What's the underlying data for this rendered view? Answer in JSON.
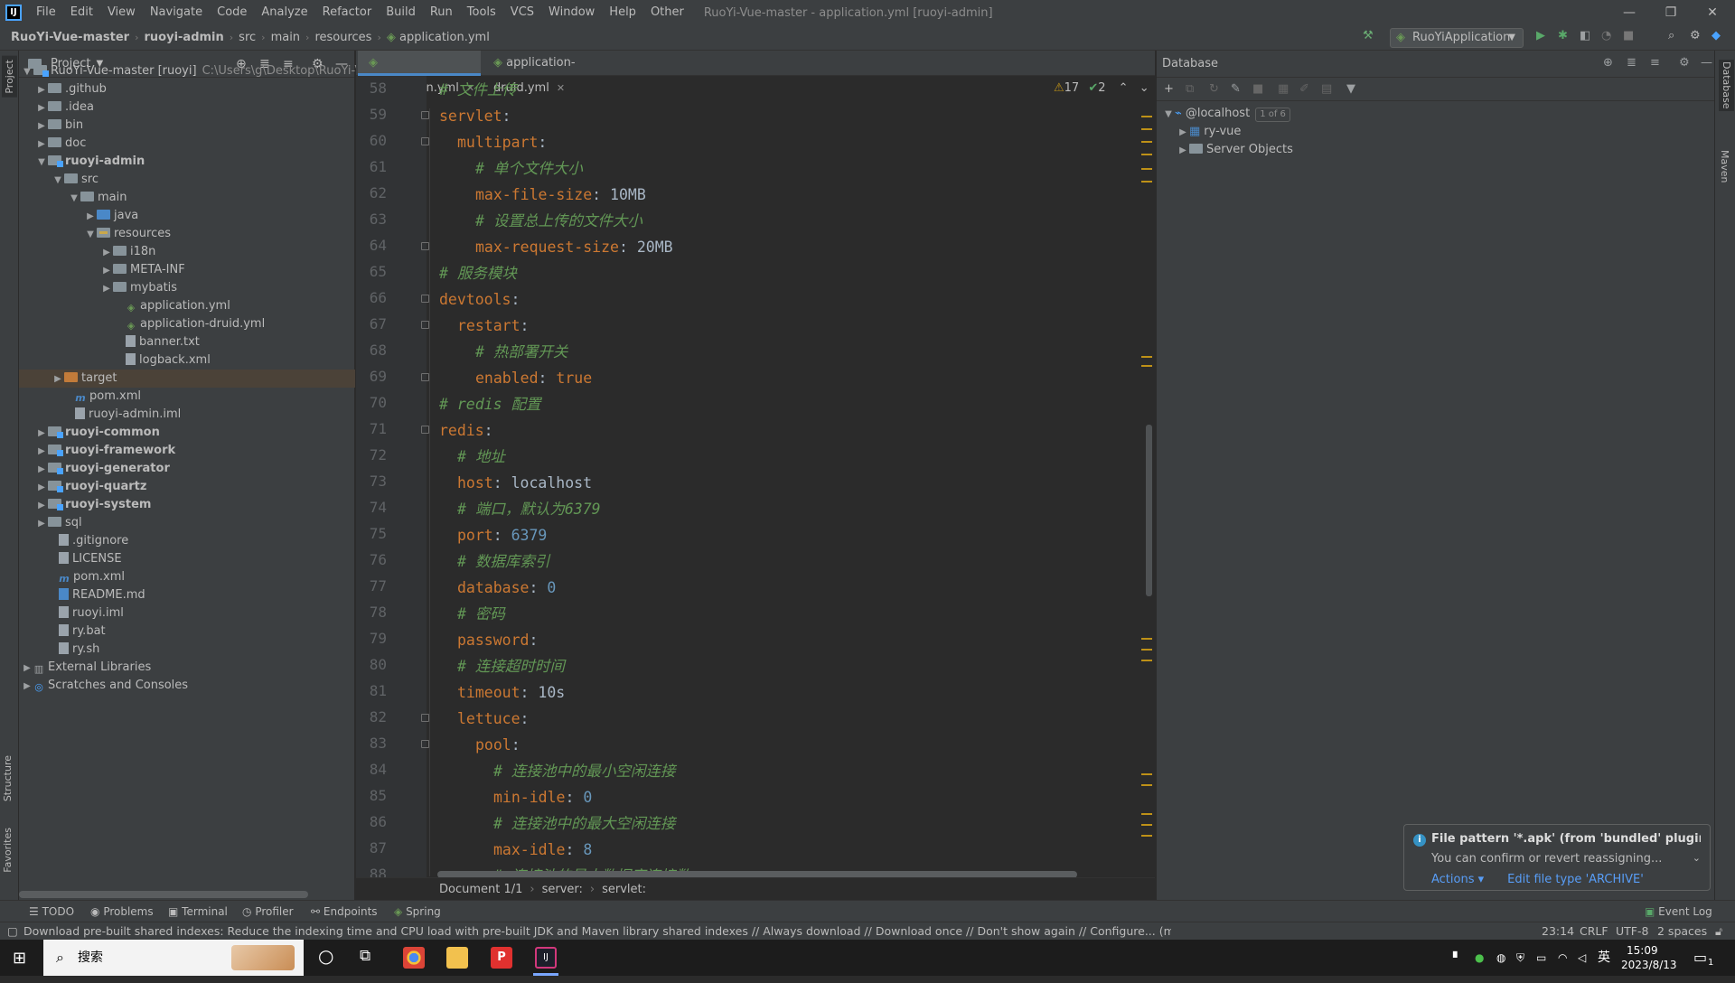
{
  "menubar": {
    "logo": "IJ",
    "items": [
      "File",
      "Edit",
      "View",
      "Navigate",
      "Code",
      "Analyze",
      "Refactor",
      "Build",
      "Run",
      "Tools",
      "VCS",
      "Window",
      "Help",
      "Other"
    ],
    "window_title": "RuoYi-Vue-master - application.yml [ruoyi-admin]"
  },
  "breadcrumb": [
    "RuoYi-Vue-master",
    "ruoyi-admin",
    "src",
    "main",
    "resources",
    "application.yml"
  ],
  "run_config": "RuoYiApplication",
  "project_panel": {
    "title": "Project",
    "tree": [
      {
        "label": "RuoYi-Vue-master [ruoyi]",
        "extra": "C:\\Users\\g\\Desktop\\RuoYi-Vu"
      },
      {
        "label": ".github"
      },
      {
        "label": ".idea"
      },
      {
        "label": "bin"
      },
      {
        "label": "doc"
      },
      {
        "label": "ruoyi-admin"
      },
      {
        "label": "src"
      },
      {
        "label": "main"
      },
      {
        "label": "java"
      },
      {
        "label": "resources"
      },
      {
        "label": "i18n"
      },
      {
        "label": "META-INF"
      },
      {
        "label": "mybatis"
      },
      {
        "label": "application.yml"
      },
      {
        "label": "application-druid.yml"
      },
      {
        "label": "banner.txt"
      },
      {
        "label": "logback.xml"
      },
      {
        "label": "target"
      },
      {
        "label": "pom.xml"
      },
      {
        "label": "ruoyi-admin.iml"
      },
      {
        "label": "ruoyi-common"
      },
      {
        "label": "ruoyi-framework"
      },
      {
        "label": "ruoyi-generator"
      },
      {
        "label": "ruoyi-quartz"
      },
      {
        "label": "ruoyi-system"
      },
      {
        "label": "sql"
      },
      {
        "label": ".gitignore"
      },
      {
        "label": "LICENSE"
      },
      {
        "label": "pom.xml"
      },
      {
        "label": "README.md"
      },
      {
        "label": "ruoyi.iml"
      },
      {
        "label": "ry.bat"
      },
      {
        "label": "ry.sh"
      },
      {
        "label": "External Libraries"
      },
      {
        "label": "Scratches and Consoles"
      }
    ]
  },
  "left_strip": {
    "project": "Project",
    "structure": "Structure",
    "favorites": "Favorites"
  },
  "right_strip": {
    "database": "Database",
    "maven": "Maven"
  },
  "editor": {
    "tabs": [
      {
        "label": "application.yml"
      },
      {
        "label": "application-druid.yml"
      }
    ],
    "inspections": {
      "warnings": "17",
      "ok": "2"
    },
    "lines": [
      "58",
      "59",
      "60",
      "61",
      "62",
      "63",
      "64",
      "65",
      "66",
      "67",
      "68",
      "69",
      "70",
      "71",
      "72",
      "73",
      "74",
      "75",
      "76",
      "77",
      "78",
      "79",
      "80",
      "81",
      "82",
      "83",
      "84",
      "85",
      "86",
      "87",
      "88"
    ],
    "code": {
      "l58c": "# 文件上传",
      "l59k": "servlet",
      "l60k": "multipart",
      "l61c": "# 单个文件大小",
      "l62k": "max-file-size",
      "l62v": "10MB",
      "l63c": "# 设置总上传的文件大小",
      "l64k": "max-request-size",
      "l64v": "20MB",
      "l65c": "# 服务模块",
      "l66k": "devtools",
      "l67k": "restart",
      "l68c": "# 热部署开关",
      "l69k": "enabled",
      "l69v": "true",
      "l70c": "# redis 配置",
      "l71k": "redis",
      "l72c": "# 地址",
      "l73k": "host",
      "l73v": "localhost",
      "l74c": "# 端口，默认为6379",
      "l75k": "port",
      "l75v": "6379",
      "l76c": "# 数据库索引",
      "l77k": "database",
      "l77v": "0",
      "l78c": "# 密码",
      "l79k": "password",
      "l80c": "# 连接超时时间",
      "l81k": "timeout",
      "l81v": "10s",
      "l82k": "lettuce",
      "l83k": "pool",
      "l84c": "# 连接池中的最小空闲连接",
      "l85k": "min-idle",
      "l85v": "0",
      "l86c": "# 连接池中的最大空闲连接",
      "l87k": "max-idle",
      "l87v": "8",
      "l88c": "# 连接池的最大数据库连接数"
    },
    "breadcrumb": [
      "Document 1/1",
      "server:",
      "servlet:"
    ]
  },
  "database": {
    "title": "Database",
    "host": "@localhost",
    "host_badge": "1 of 6",
    "items": [
      "ry-vue",
      "Server Objects"
    ]
  },
  "notification": {
    "title": "File pattern '*.apk' (from 'bundled' plugin) w",
    "body": "You can confirm or revert reassigning...",
    "action1": "Actions ▾",
    "action2": "Edit file type 'ARCHIVE'"
  },
  "bottom_tools": [
    "TODO",
    "Problems",
    "Terminal",
    "Profiler",
    "Endpoints",
    "Spring"
  ],
  "event_log": "Event Log",
  "status": {
    "message": "Download pre-built shared indexes: Reduce the indexing time and CPU load with pre-built JDK and Maven library shared indexes // Always download // Download once // Don't show again // Configure... (moments ago)",
    "position": "23:14",
    "line_sep": "CRLF",
    "encoding": "UTF-8",
    "indent": "2 spaces"
  },
  "taskbar": {
    "search": "搜索",
    "ime": "英",
    "time": "15:09",
    "date": "2023/8/13",
    "notif_count": "1"
  },
  "colors": {
    "accent": "#4a88c7",
    "key": "#cc7832",
    "comment": "#629755",
    "number": "#6897bb",
    "warning": "#be9117"
  }
}
